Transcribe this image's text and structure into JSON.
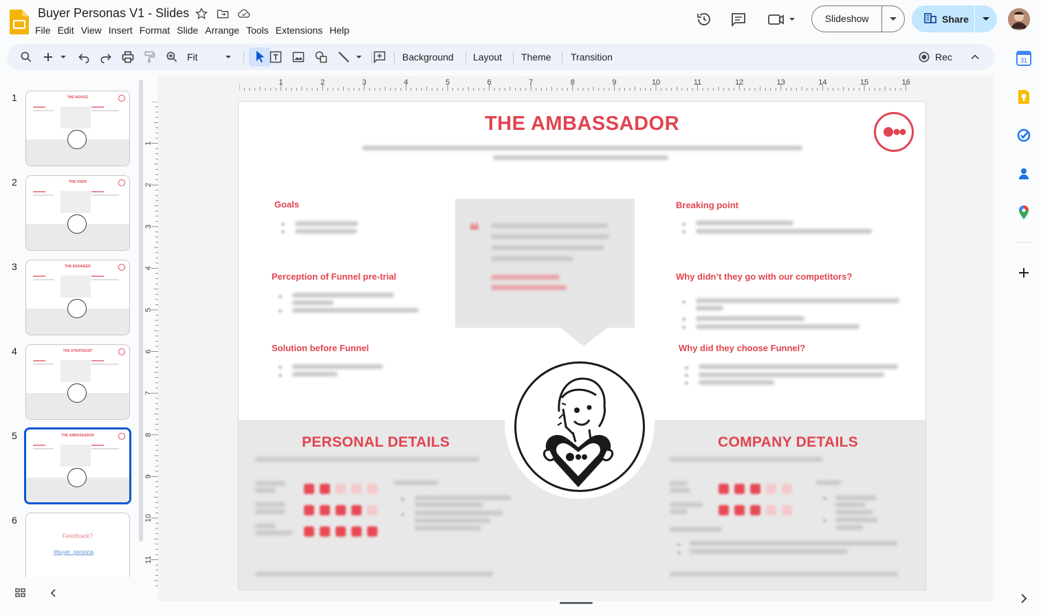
{
  "window": {
    "doc_title": "Buyer Personas V1 - Slides",
    "menu": [
      "File",
      "Edit",
      "View",
      "Insert",
      "Format",
      "Slide",
      "Arrange",
      "Tools",
      "Extensions",
      "Help"
    ],
    "slideshow_label": "Slideshow",
    "share_label": "Share"
  },
  "toolbar": {
    "zoom_label": "Fit",
    "background_label": "Background",
    "layout_label": "Layout",
    "theme_label": "Theme",
    "transition_label": "Transition",
    "rec_label": "Rec"
  },
  "ruler": {
    "h_ticks": [
      "1",
      "2",
      "3",
      "4",
      "5",
      "6",
      "7",
      "8",
      "9",
      "10",
      "11",
      "12",
      "13",
      "14",
      "15",
      "16"
    ],
    "v_ticks": [
      "1",
      "2",
      "3",
      "4",
      "5",
      "6",
      "7",
      "8",
      "9",
      "10",
      "11"
    ]
  },
  "filmstrip": {
    "slides": [
      {
        "num": "1",
        "title": "THE NOVICE"
      },
      {
        "num": "2",
        "title": "THE FIXER"
      },
      {
        "num": "3",
        "title": "THE ENGINEER"
      },
      {
        "num": "4",
        "title": "THE STRATEGIST"
      },
      {
        "num": "5",
        "title": "THE AMBASSADOR"
      },
      {
        "num": "6",
        "title": "Feedback?",
        "link": "#buyer_persona"
      }
    ],
    "active_index": 5
  },
  "slide": {
    "title": "THE AMBASSADOR",
    "goals": "Goals",
    "perception": "Perception of Funnel pre-trial",
    "solution": "Solution before Funnel",
    "breaking_point": "Breaking point",
    "competitors": "Why didn’t they go with our competitors?",
    "why_funnel": "Why did they choose Funnel?",
    "personal_details": "PERSONAL DETAILS",
    "company_details": "COMPANY DETAILS"
  },
  "colors": {
    "accent": "#e0444f",
    "share_bg": "#c2e7ff",
    "active_blue": "#0b57d0"
  }
}
